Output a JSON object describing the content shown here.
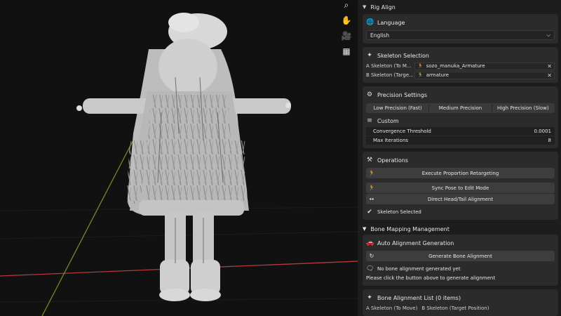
{
  "viewport_tools": [
    "zoom-icon",
    "hand-icon",
    "camera-icon",
    "grid-icon"
  ],
  "panel": {
    "title": "Rig Align",
    "language": {
      "heading": "Language",
      "value": "English"
    },
    "skeleton_selection": {
      "heading": "Skeleton Selection",
      "a_label": "A Skeleton (To M...",
      "a_value": "sozo_manuka_Armature",
      "b_label": "B Skeleton (Targe...",
      "b_value": "armature"
    },
    "precision": {
      "heading": "Precision Settings",
      "options": [
        "Low Precision (Fast)",
        "Medium Precision",
        "High Precision (Slow)"
      ],
      "custom_label": "Custom",
      "convergence_label": "Convergence Threshold",
      "convergence_value": "0.0001",
      "max_iter_label": "Max Iterations",
      "max_iter_value": "8"
    },
    "operations": {
      "heading": "Operations",
      "execute": "Execute Proportion Retargeting",
      "sync": "Sync Pose to Edit Mode",
      "direct": "Direct Head/Tail Alignment",
      "status": "Skeleton Selected"
    },
    "bone_mapping": {
      "heading": "Bone Mapping Management",
      "auto_label": "Auto Alignment Generation",
      "generate": "Generate Bone Alignment",
      "no_alignment": "No bone alignment generated yet",
      "hint": "Please click the button above to generate alignment",
      "list_label": "Bone Alignment List (0 items)",
      "col_a": "A Skeleton (To Move)",
      "col_b": "B Skeleton (Target Position)"
    }
  },
  "colors": {
    "panel_bg": "#1d1d1d",
    "box_bg": "#2b2b2b",
    "button_bg": "#3d3d3d",
    "axis_red": "#b53a3a",
    "axis_green": "#6f8a2a"
  }
}
